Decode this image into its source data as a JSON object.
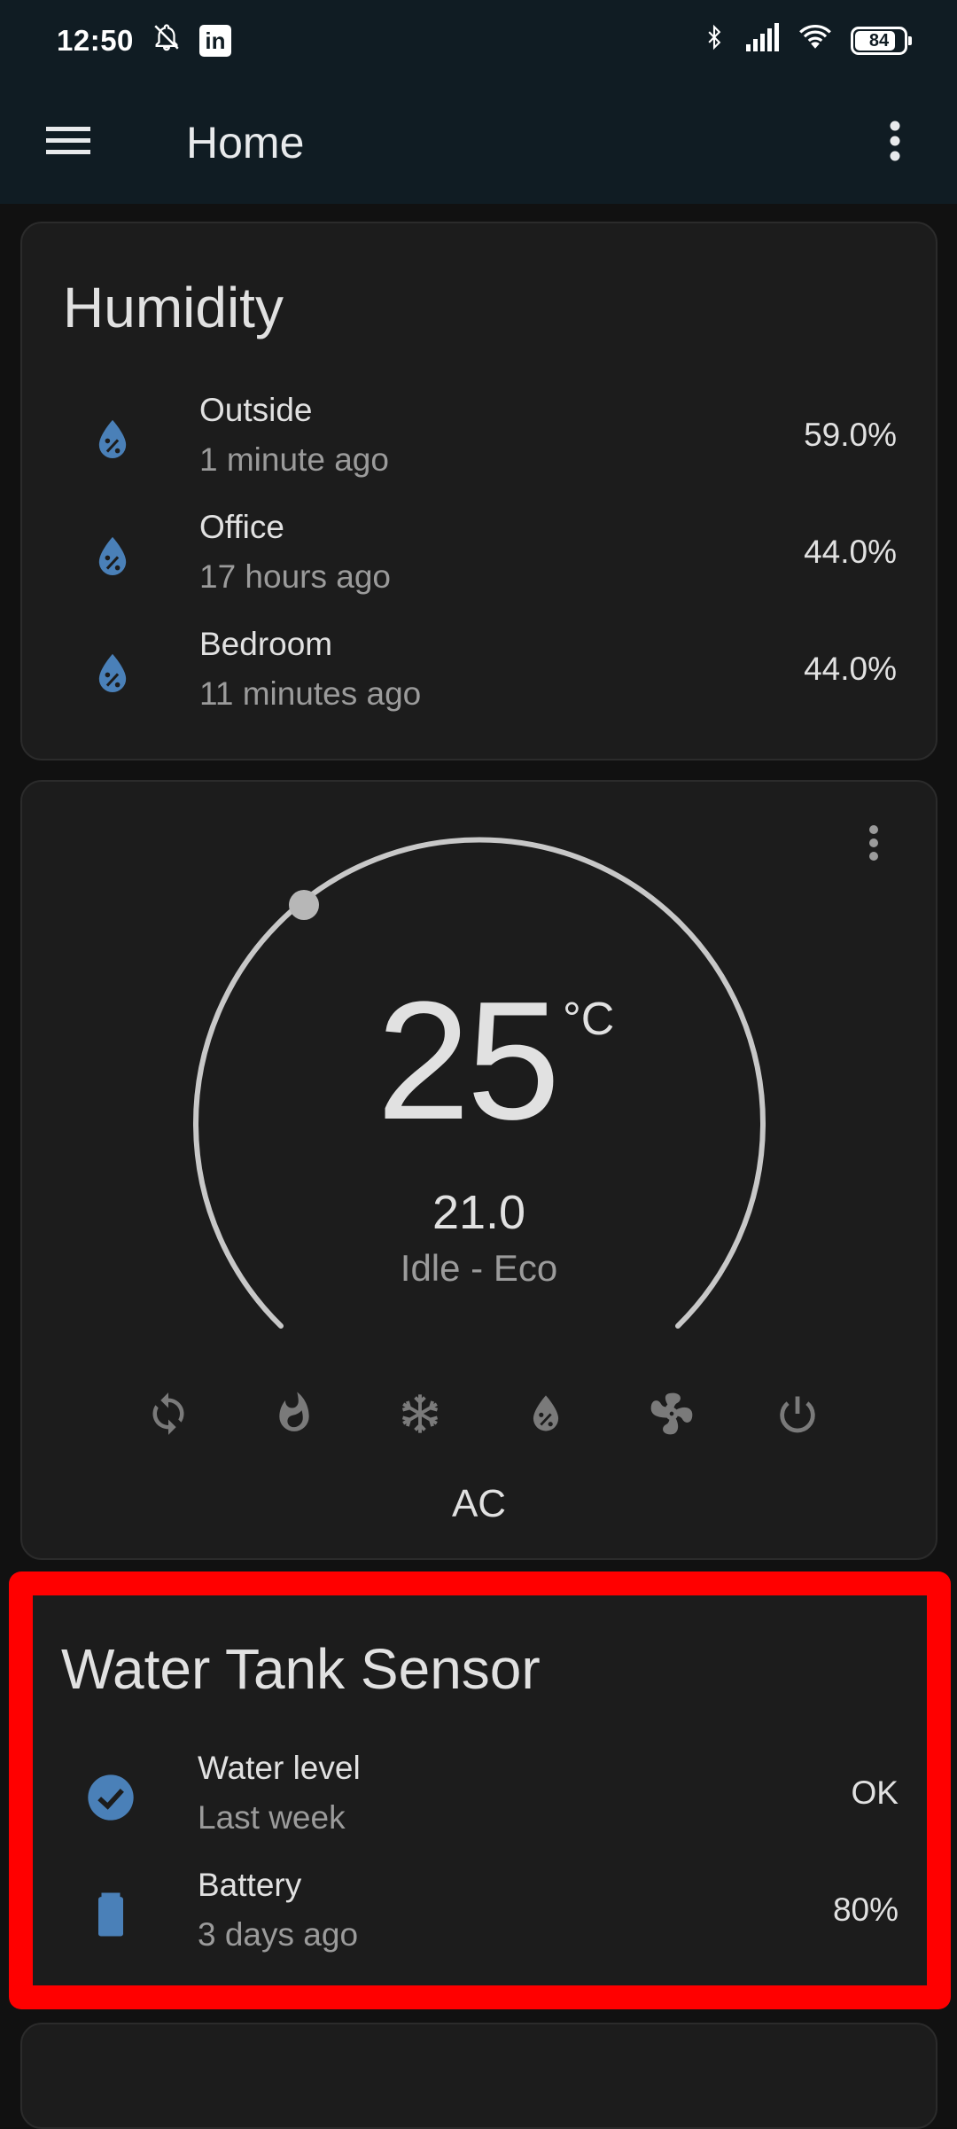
{
  "status_bar": {
    "time": "12:50",
    "linkedin_badge": "in",
    "battery_level": "84",
    "icons": [
      "bell-off-icon",
      "linkedin-icon",
      "bluetooth-icon",
      "signal-icon",
      "wifi-icon",
      "battery-icon"
    ]
  },
  "app_bar": {
    "title": "Home",
    "menu_icon": "hamburger-menu-icon",
    "overflow_icon": "more-vertical-icon"
  },
  "humidity_card": {
    "title": "Humidity",
    "icon": "water-percent-icon",
    "icon_color": "#4a80b8",
    "rows": [
      {
        "name": "Outside",
        "time": "1 minute ago",
        "value": "59.0%"
      },
      {
        "name": "Office",
        "time": "17 hours ago",
        "value": "44.0%"
      },
      {
        "name": "Bedroom",
        "time": "11 minutes ago",
        "value": "44.0%"
      }
    ]
  },
  "thermostat_card": {
    "target_temperature": "25",
    "unit": "°C",
    "current_temperature": "21.0",
    "status": "Idle - Eco",
    "active_mode_label": "AC",
    "dial_color": "#c8c8c8",
    "modes": [
      {
        "name": "auto",
        "icon": "sync-icon"
      },
      {
        "name": "heat",
        "icon": "fire-icon"
      },
      {
        "name": "cool",
        "icon": "snowflake-icon"
      },
      {
        "name": "dry",
        "icon": "water-percent-icon"
      },
      {
        "name": "fan",
        "icon": "fan-icon"
      },
      {
        "name": "off",
        "icon": "power-icon"
      }
    ]
  },
  "water_tank_card": {
    "title": "Water Tank Sensor",
    "icon_color": "#4a80b8",
    "rows": [
      {
        "name": "Water level",
        "time": "Last week",
        "value": "OK",
        "icon": "check-circle-icon"
      },
      {
        "name": "Battery",
        "time": "3 days ago",
        "value": "80%",
        "icon": "battery-icon"
      }
    ]
  },
  "highlight_color": "#ff0000"
}
